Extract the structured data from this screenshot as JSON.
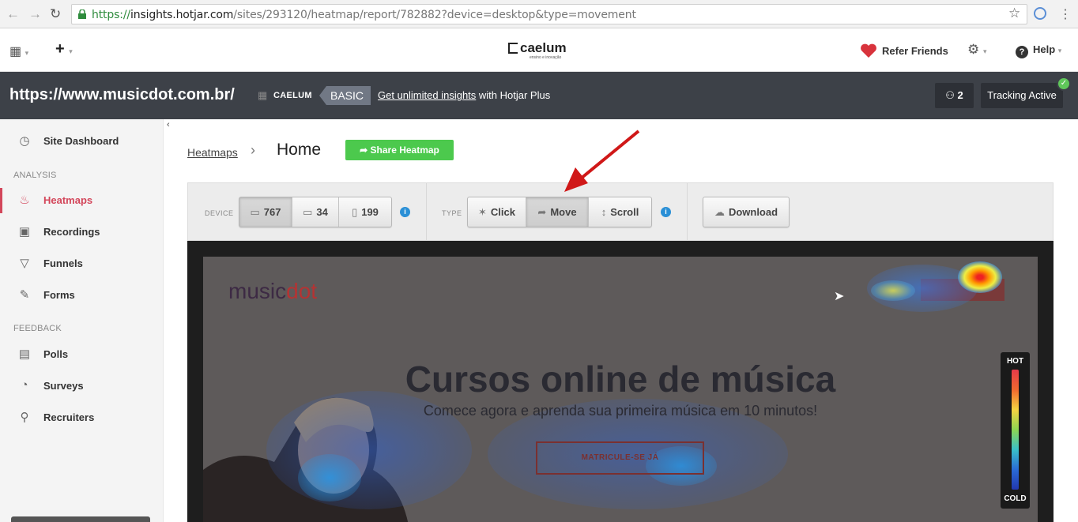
{
  "browser": {
    "url_scheme": "https://",
    "url_host": "insights.hotjar.com",
    "url_path": "/sites/293120/heatmap/report/782882?device=desktop&type=movement",
    "back_icon": "arrow-left-icon",
    "forward_icon": "arrow-right-icon",
    "reload_icon": "reload-icon",
    "bookmark_icon": "star-icon"
  },
  "header": {
    "logo": "caelum",
    "logo_tagline": "ensino e inovação",
    "refer_label": "Refer Friends",
    "help_label": "Help"
  },
  "site_bar": {
    "site_url": "https://www.musicdot.com.br/",
    "org_name": "CAELUM",
    "plan": "BASIC",
    "upgrade_link": "Get unlimited insights",
    "upgrade_rest": " with Hotjar Plus",
    "users_count": "2",
    "tracking_label": "Tracking Active"
  },
  "sidebar": {
    "dashboard": "Site Dashboard",
    "section_analysis": "ANALYSIS",
    "heatmaps": "Heatmaps",
    "recordings": "Recordings",
    "funnels": "Funnels",
    "forms": "Forms",
    "section_feedback": "FEEDBACK",
    "polls": "Polls",
    "surveys": "Surveys",
    "recruiters": "Recruiters"
  },
  "main": {
    "breadcrumb": "Heatmaps",
    "title": "Home",
    "share_label": "Share Heatmap"
  },
  "toolbar": {
    "device_label": "DEVICE",
    "desktop_count": "767",
    "tablet_count": "34",
    "mobile_count": "199",
    "type_label": "TYPE",
    "click_label": "Click",
    "move_label": "Move",
    "scroll_label": "Scroll",
    "download_label": "Download",
    "active_type": "Move",
    "active_device": "desktop"
  },
  "heatmap": {
    "site_logo_a": "music",
    "site_logo_b": "dot",
    "hero_title": "Cursos online de música",
    "hero_subtitle": "Comece agora e aprenda sua primeira música em 10 minutos!",
    "hero_button": "MATRICULE-SE JÁ",
    "legend_hot": "HOT",
    "legend_cold": "COLD"
  },
  "colors": {
    "accent_red": "#d3465a",
    "share_green": "#4cc94d",
    "dark_bar": "#3d4148",
    "annotation_arrow": "#d01818"
  }
}
